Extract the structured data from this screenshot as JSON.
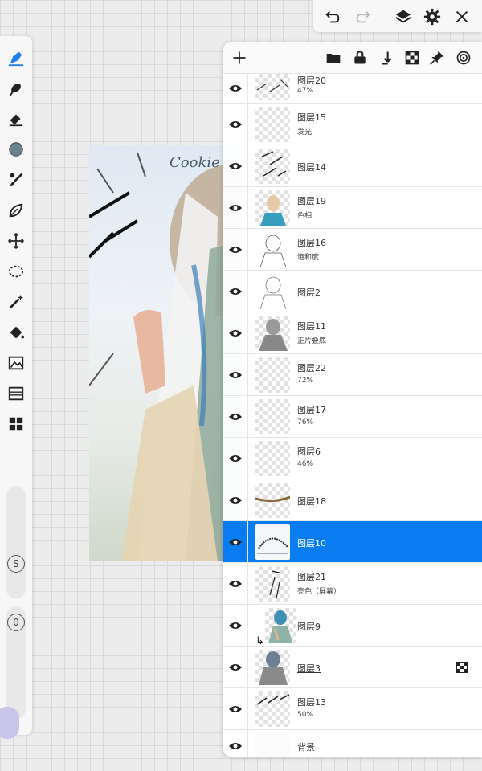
{
  "canvas": {
    "signature": "Cookie"
  },
  "left_toolbar": {
    "tools": [
      "brush-tool",
      "smudge-tool",
      "eraser-tool",
      "color-swatch",
      "brush-library",
      "lasso-tool",
      "move-tool",
      "shape-lasso-tool",
      "magic-wand-tool",
      "fill-tool",
      "image-adjust-tool",
      "filter-tool",
      "layout-tool"
    ],
    "brush_color": "#6d8290",
    "size_badge": "S",
    "opacity_badge": "0"
  },
  "top_toolbar": {
    "buttons": [
      "undo-icon",
      "redo-icon",
      "layers-icon",
      "gear-icon",
      "close-icon"
    ]
  },
  "layers_panel": {
    "header_buttons": [
      "add-layer-icon",
      "folder-icon",
      "lock-icon",
      "merge-down-icon",
      "checker-icon",
      "pin-icon",
      "target-icon"
    ],
    "selected_color": "#0a7cf2",
    "layers": [
      {
        "name": "图层20",
        "sub": "47%"
      },
      {
        "name": "图层15",
        "sub": "发光"
      },
      {
        "name": "图层14",
        "sub": ""
      },
      {
        "name": "图层19",
        "sub": "色相"
      },
      {
        "name": "图层16",
        "sub": "饱和度"
      },
      {
        "name": "图层2",
        "sub": ""
      },
      {
        "name": "图层11",
        "sub": "正片叠底"
      },
      {
        "name": "图层22",
        "sub": "72%"
      },
      {
        "name": "图层17",
        "sub": "76%"
      },
      {
        "name": "图层6",
        "sub": "46%"
      },
      {
        "name": "图层18",
        "sub": ""
      },
      {
        "name": "图层10",
        "sub": ""
      },
      {
        "name": "图层21",
        "sub": "亮色（屏幕）"
      },
      {
        "name": "图层9",
        "sub": ""
      },
      {
        "name": "图层3",
        "sub": ""
      },
      {
        "name": "图层13",
        "sub": "50%"
      },
      {
        "name": "背景",
        "sub": ""
      }
    ]
  }
}
